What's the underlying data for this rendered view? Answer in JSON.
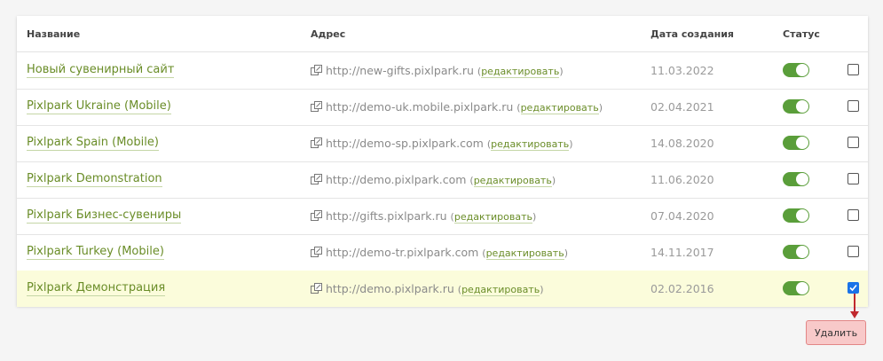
{
  "table": {
    "headers": {
      "name": "Название",
      "address": "Адрес",
      "created": "Дата создания",
      "status": "Статус"
    },
    "edit_label": "редактировать",
    "rows": [
      {
        "name": "Новый сувенирный сайт",
        "url": "http://new-gifts.pixlpark.ru",
        "date": "11.03.2022",
        "status_on": true,
        "checked": false
      },
      {
        "name": "Pixlpark Ukraine (Mobile)",
        "url": "http://demo-uk.mobile.pixlpark.ru",
        "date": "02.04.2021",
        "status_on": true,
        "checked": false
      },
      {
        "name": "Pixlpark Spain (Mobile)",
        "url": "http://demo-sp.pixlpark.com",
        "date": "14.08.2020",
        "status_on": true,
        "checked": false
      },
      {
        "name": "Pixlpark Demonstration",
        "url": "http://demo.pixlpark.com",
        "date": "11.06.2020",
        "status_on": true,
        "checked": false
      },
      {
        "name": "Pixlpark Бизнес-сувениры",
        "url": "http://gifts.pixlpark.ru",
        "date": "07.04.2020",
        "status_on": true,
        "checked": false
      },
      {
        "name": "Pixlpark Turkey (Mobile)",
        "url": "http://demo-tr.pixlpark.com",
        "date": "14.11.2017",
        "status_on": true,
        "checked": false
      },
      {
        "name": "Pixlpark Демонстрация",
        "url": "http://demo.pixlpark.ru",
        "date": "02.02.2016",
        "status_on": true,
        "checked": true
      }
    ]
  },
  "actions": {
    "delete_label": "Удалить"
  },
  "colors": {
    "link_green": "#6a8d28",
    "toggle_green": "#5a9e3a",
    "selected_row": "#fbfcdb",
    "delete_bg": "#f8c9c9",
    "arrow_red": "#c0282d",
    "checkbox_blue": "#1a73e8"
  }
}
